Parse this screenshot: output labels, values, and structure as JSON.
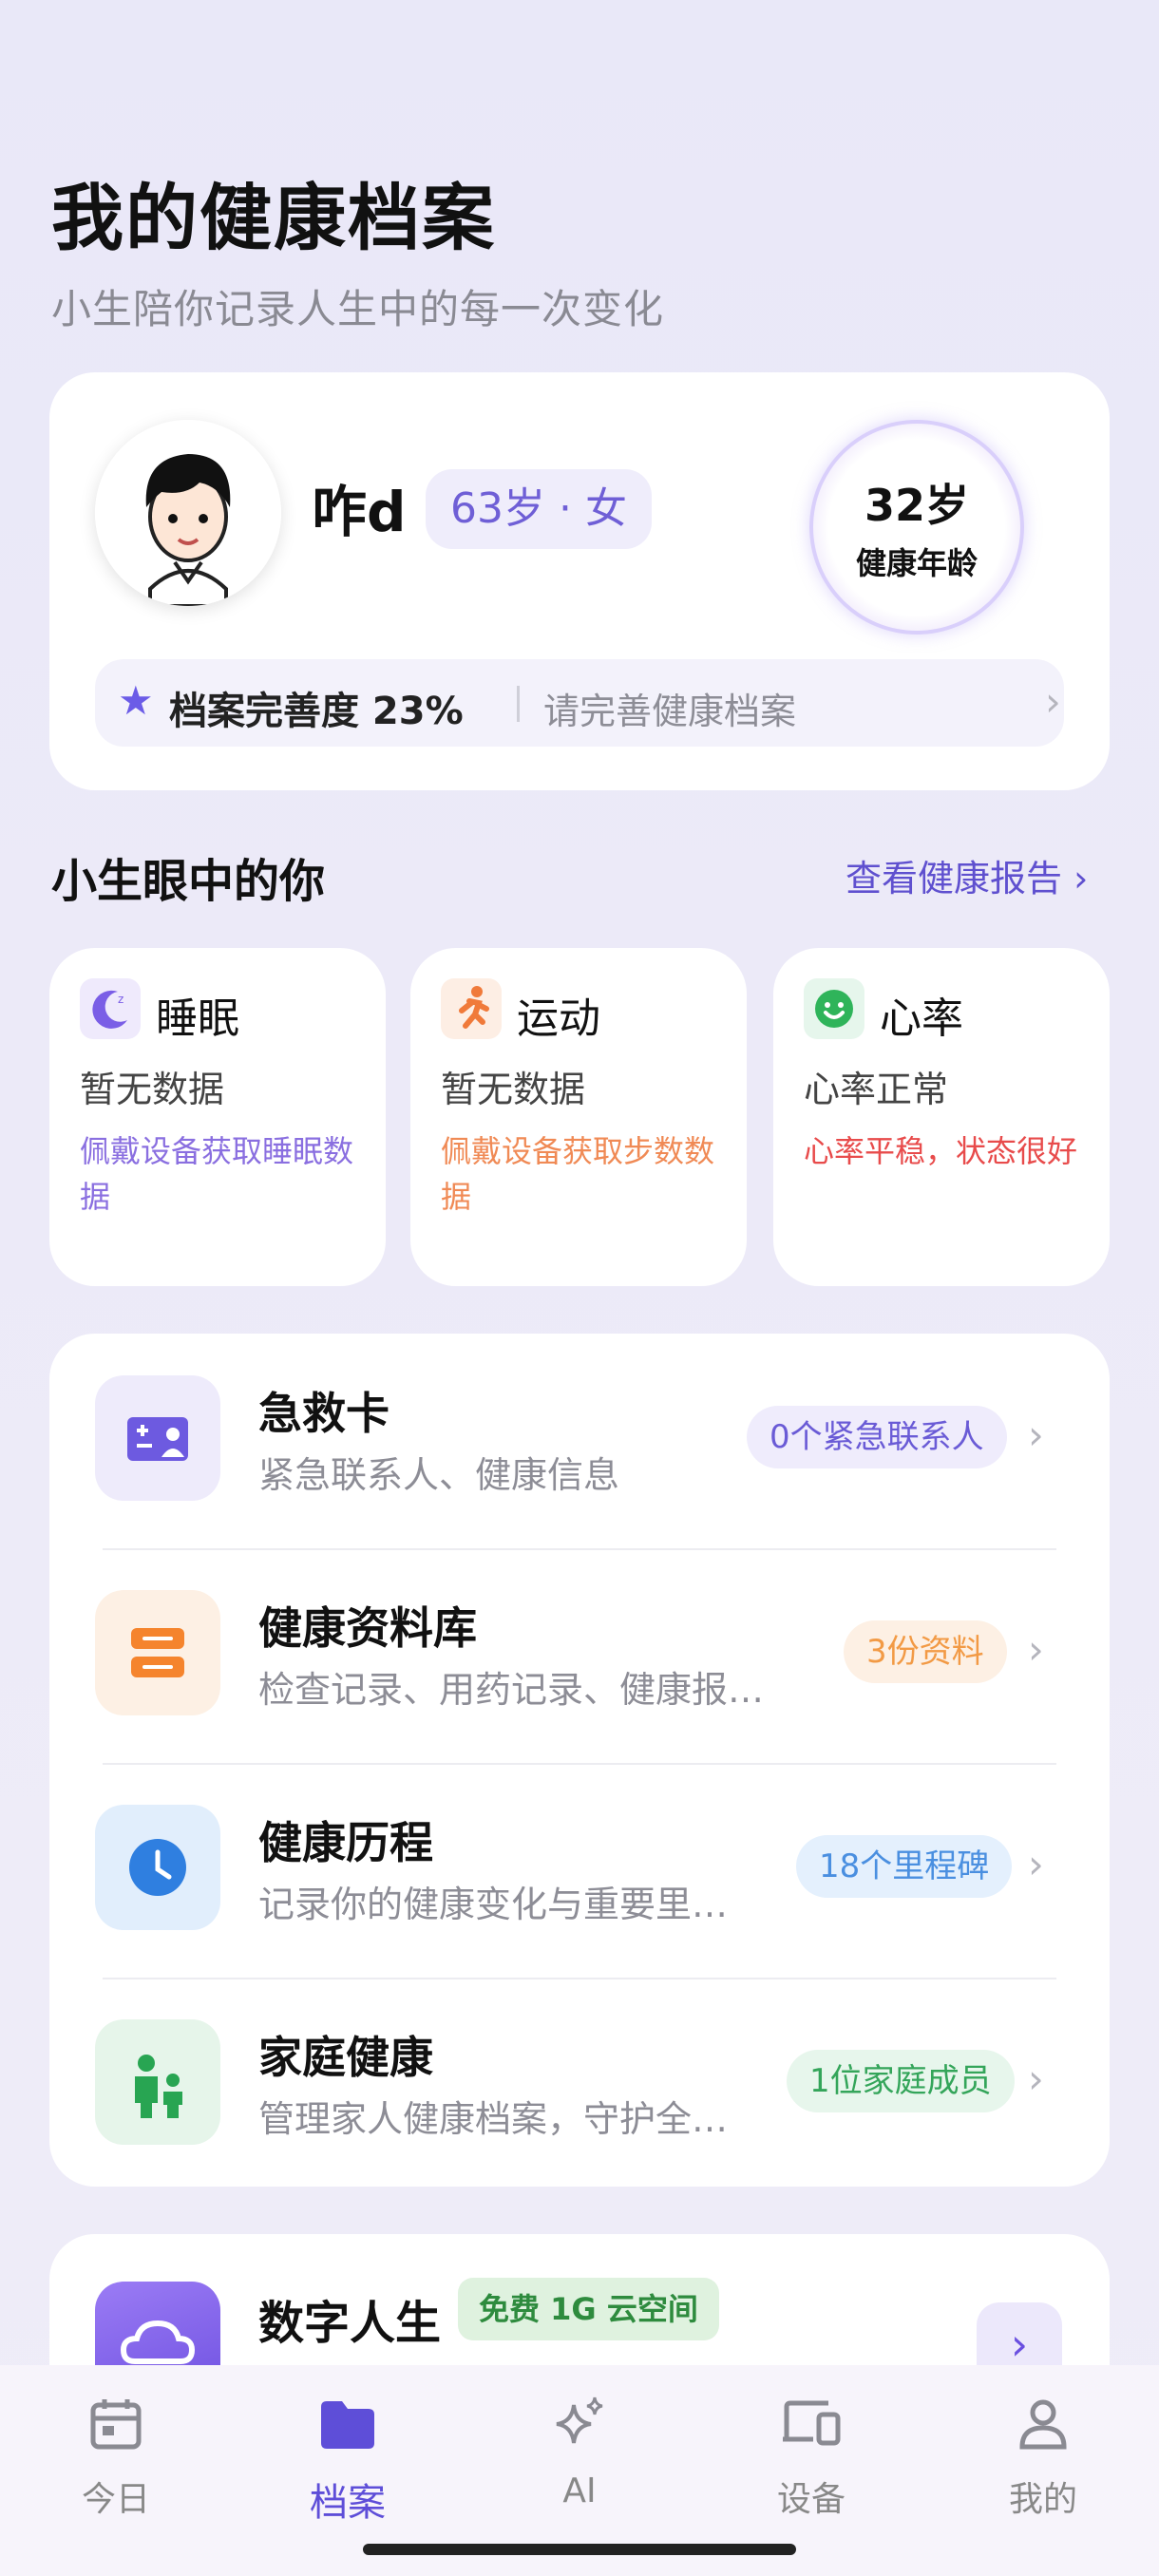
{
  "header": {
    "title": "我的健康档案",
    "subtitle": "小生陪你记录人生中的每一次变化"
  },
  "profile": {
    "name": "咋d",
    "age_gender": "63岁 · 女",
    "health_age": "32岁",
    "health_age_label": "健康年龄",
    "completeness": "档案完善度 23%",
    "completeness_hint": "请完善健康档案"
  },
  "insights": {
    "title": "小生眼中的你",
    "link": "查看健康报告 ›",
    "cards": [
      {
        "name": "睡眠",
        "value": "暂无数据",
        "hint": "佩戴设备获取睡眠数据",
        "hint_color": "#8a6fe0",
        "icon": "moon-icon"
      },
      {
        "name": "运动",
        "value": "暂无数据",
        "hint": "佩戴设备获取步数数据",
        "hint_color": "#f08a55",
        "icon": "running-icon"
      },
      {
        "name": "心率",
        "value": "心率正常",
        "hint": "心率平稳，状态很好",
        "hint_color": "#e84b4b",
        "icon": "smile-icon"
      }
    ]
  },
  "records": [
    {
      "title": "急救卡",
      "desc": "紧急联系人、健康信息",
      "badge": "0个紧急联系人",
      "icon": "emergency-card-icon",
      "badge_bg": "#efecfc",
      "badge_fg": "#6a5bd6"
    },
    {
      "title": "健康资料库",
      "desc": "检查记录、用药记录、健康报…",
      "badge": "3份资料",
      "icon": "database-icon",
      "badge_bg": "#fdf0e4",
      "badge_fg": "#f29a45"
    },
    {
      "title": "健康历程",
      "desc": "记录你的健康变化与重要里…",
      "badge": "18个里程碑",
      "icon": "clock-icon",
      "badge_bg": "#e4f0fd",
      "badge_fg": "#4a8fe0"
    },
    {
      "title": "家庭健康",
      "desc": "管理家人健康档案，守护全…",
      "badge": "1位家庭成员",
      "icon": "family-icon",
      "badge_bg": "#e7f6ec",
      "badge_fg": "#34a55a"
    }
  ],
  "digital_life": {
    "title": "数字人生",
    "badge": "免费 1G 云空间"
  },
  "nav": [
    {
      "label": "今日",
      "icon": "calendar-icon",
      "active": false
    },
    {
      "label": "档案",
      "icon": "folder-icon",
      "active": true
    },
    {
      "label": "AI",
      "icon": "sparkle-icon",
      "active": false
    },
    {
      "label": "设备",
      "icon": "devices-icon",
      "active": false
    },
    {
      "label": "我的",
      "icon": "person-icon",
      "active": false
    }
  ]
}
